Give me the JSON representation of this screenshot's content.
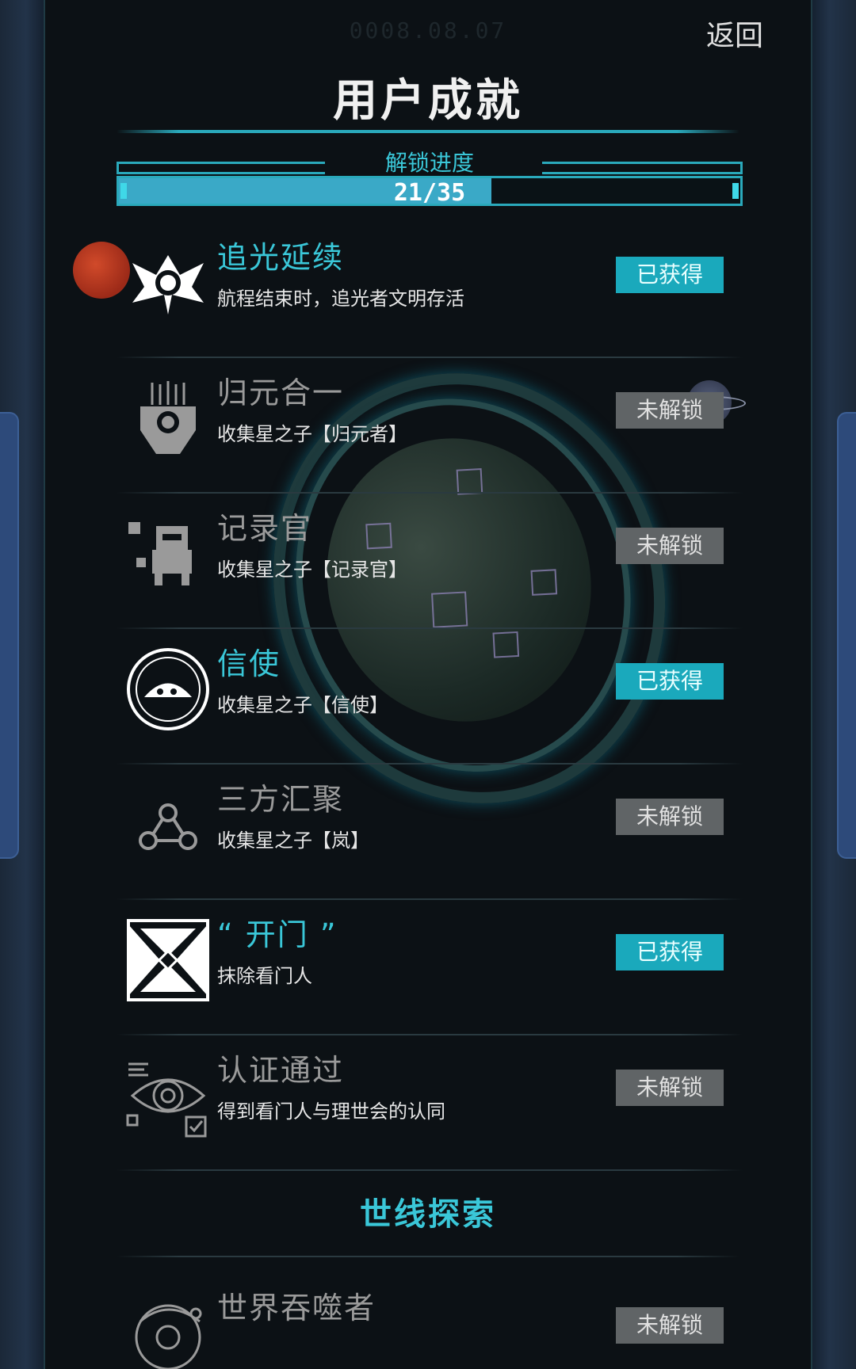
{
  "header": {
    "date": "0008.08.07",
    "back_label": "返回",
    "title": "用户成就"
  },
  "progress": {
    "label": "解锁进度",
    "text": "21/35",
    "fraction": 0.6
  },
  "achievements": [
    {
      "name": "追光延续",
      "desc": "航程结束时，追光者文明存活",
      "status": "已获得",
      "unlocked": true,
      "icon": "winged-star-icon"
    },
    {
      "name": "归元合一",
      "desc": "收集星之子【归元者】",
      "status": "未解锁",
      "unlocked": false,
      "icon": "mask-icon"
    },
    {
      "name": "记录官",
      "desc": "收集星之子【记录官】",
      "status": "未解锁",
      "unlocked": false,
      "icon": "robot-icon"
    },
    {
      "name": "信使",
      "desc": "收集星之子【信使】",
      "status": "已获得",
      "unlocked": true,
      "icon": "ship-circle-icon"
    },
    {
      "name": "三方汇聚",
      "desc": "收集星之子【岚】",
      "status": "未解锁",
      "unlocked": false,
      "icon": "network-icon"
    },
    {
      "name": "“ 开门 ”",
      "desc": "抹除看门人",
      "status": "已获得",
      "unlocked": true,
      "icon": "gate-icon"
    },
    {
      "name": "认证通过",
      "desc": "得到看门人与理世会的认同",
      "status": "未解锁",
      "unlocked": false,
      "icon": "eye-check-icon"
    }
  ],
  "section": {
    "title": "世线探索"
  },
  "section_items": [
    {
      "name": "世界吞噬者",
      "desc": "",
      "status": "未解锁",
      "unlocked": false,
      "icon": "orbit-icon"
    }
  ],
  "colors": {
    "accent": "#3ac7d8",
    "got_badge": "#1aa9bc",
    "lock_badge": "#606466"
  }
}
